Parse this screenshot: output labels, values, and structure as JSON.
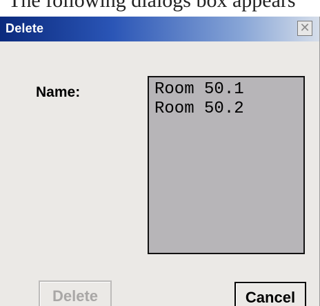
{
  "background": {
    "partial_text": "The following dialogs box appears"
  },
  "dialog": {
    "title": "Delete",
    "close_symbol": "✕"
  },
  "form": {
    "name_label": "Name:",
    "items": [
      "Room 50.1",
      "Room 50.2"
    ]
  },
  "buttons": {
    "delete": {
      "label": "Delete",
      "enabled": false
    },
    "cancel": {
      "label": "Cancel"
    }
  },
  "colors": {
    "title_bar_start": "#0b2a7d",
    "title_bar_end": "#d6deea",
    "window_background": "#ebe9e6",
    "list_background": "#b7b5b8",
    "disabled_text": "#a9a7a6"
  }
}
